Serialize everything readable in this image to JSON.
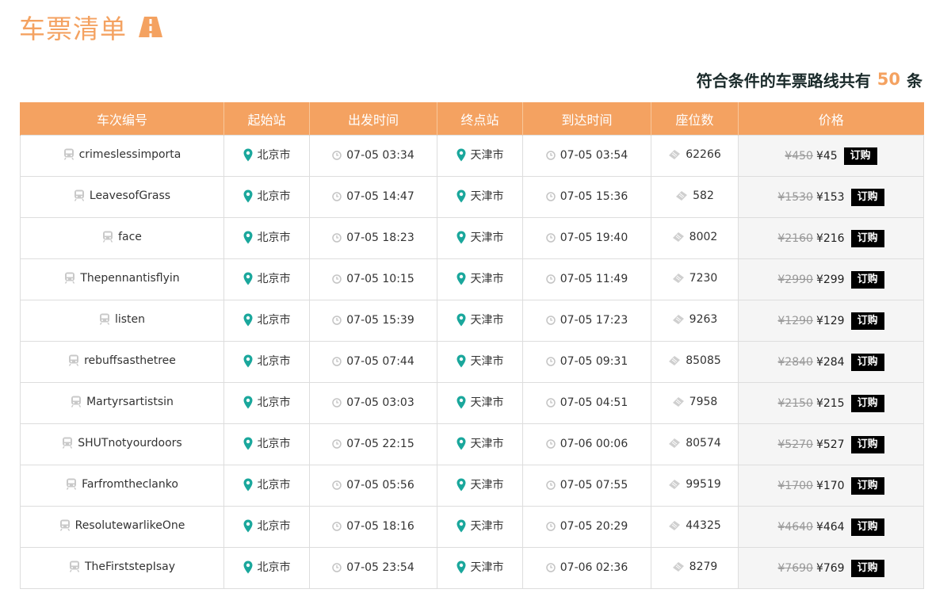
{
  "page": {
    "title": "车票清单",
    "summary_prefix": "符合条件的车票路线共有",
    "summary_count": "50",
    "summary_suffix": "条"
  },
  "colors": {
    "accent": "#f4a261",
    "pin": "#1aa79c",
    "button": "#000000"
  },
  "table": {
    "headers": [
      "车次编号",
      "起始站",
      "出发时间",
      "终点站",
      "到达时间",
      "座位数",
      "价格"
    ],
    "buy_label": "订购",
    "rows": [
      {
        "train": "crimeslessimporta",
        "from": "北京市",
        "depart": "07-05 03:34",
        "to": "天津市",
        "arrive": "07-05 03:54",
        "seats": "62266",
        "old_price": "¥450",
        "price": "¥45"
      },
      {
        "train": "LeavesofGrass",
        "from": "北京市",
        "depart": "07-05 14:47",
        "to": "天津市",
        "arrive": "07-05 15:36",
        "seats": "582",
        "old_price": "¥1530",
        "price": "¥153"
      },
      {
        "train": "face",
        "from": "北京市",
        "depart": "07-05 18:23",
        "to": "天津市",
        "arrive": "07-05 19:40",
        "seats": "8002",
        "old_price": "¥2160",
        "price": "¥216"
      },
      {
        "train": "Thepennantisflyin",
        "from": "北京市",
        "depart": "07-05 10:15",
        "to": "天津市",
        "arrive": "07-05 11:49",
        "seats": "7230",
        "old_price": "¥2990",
        "price": "¥299"
      },
      {
        "train": "listen",
        "from": "北京市",
        "depart": "07-05 15:39",
        "to": "天津市",
        "arrive": "07-05 17:23",
        "seats": "9263",
        "old_price": "¥1290",
        "price": "¥129"
      },
      {
        "train": "rebuffsasthetree",
        "from": "北京市",
        "depart": "07-05 07:44",
        "to": "天津市",
        "arrive": "07-05 09:31",
        "seats": "85085",
        "old_price": "¥2840",
        "price": "¥284"
      },
      {
        "train": "Martyrsartistsin",
        "from": "北京市",
        "depart": "07-05 03:03",
        "to": "天津市",
        "arrive": "07-05 04:51",
        "seats": "7958",
        "old_price": "¥2150",
        "price": "¥215"
      },
      {
        "train": "SHUTnotyourdoors",
        "from": "北京市",
        "depart": "07-05 22:15",
        "to": "天津市",
        "arrive": "07-06 00:06",
        "seats": "80574",
        "old_price": "¥5270",
        "price": "¥527"
      },
      {
        "train": "Farfromtheclanko",
        "from": "北京市",
        "depart": "07-05 05:56",
        "to": "天津市",
        "arrive": "07-05 07:55",
        "seats": "99519",
        "old_price": "¥1700",
        "price": "¥170"
      },
      {
        "train": "ResolutewarlikeOne",
        "from": "北京市",
        "depart": "07-05 18:16",
        "to": "天津市",
        "arrive": "07-05 20:29",
        "seats": "44325",
        "old_price": "¥4640",
        "price": "¥464"
      },
      {
        "train": "TheFirststepIsay",
        "from": "北京市",
        "depart": "07-05 23:54",
        "to": "天津市",
        "arrive": "07-06 02:36",
        "seats": "8279",
        "old_price": "¥7690",
        "price": "¥769"
      }
    ]
  }
}
